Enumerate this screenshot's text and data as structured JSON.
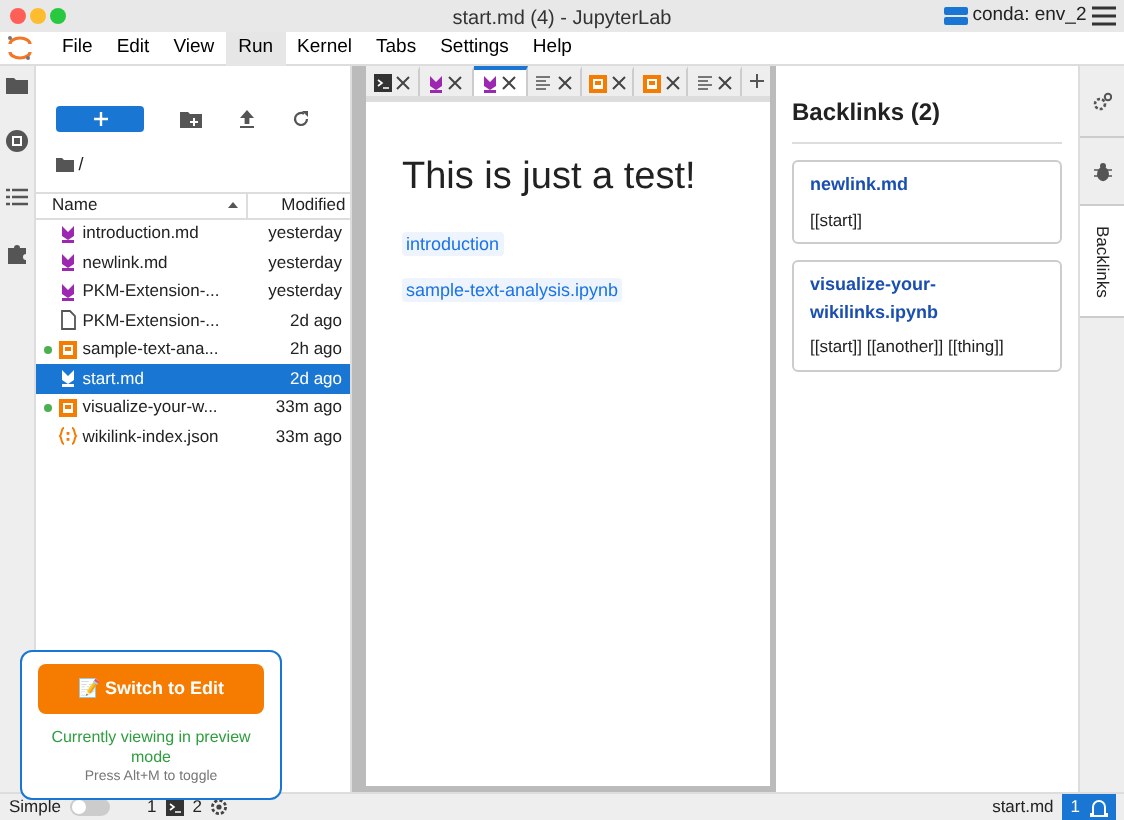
{
  "window": {
    "title": "start.md (4) - JupyterLab",
    "kernel": "conda: env_2"
  },
  "menu": [
    {
      "label": "File",
      "selected": false
    },
    {
      "label": "Edit",
      "selected": false
    },
    {
      "label": "View",
      "selected": false
    },
    {
      "label": "Run",
      "selected": true
    },
    {
      "label": "Kernel",
      "selected": false
    },
    {
      "label": "Tabs",
      "selected": false
    },
    {
      "label": "Settings",
      "selected": false
    },
    {
      "label": "Help",
      "selected": false
    }
  ],
  "file_browser": {
    "path": "/",
    "columns": [
      "Name",
      "Modified"
    ],
    "files": [
      {
        "kind": "md",
        "name": "introduction.md",
        "modified": "yesterday",
        "running": false,
        "selected": false
      },
      {
        "kind": "md",
        "name": "newlink.md",
        "modified": "yesterday",
        "running": false,
        "selected": false
      },
      {
        "kind": "md",
        "name": "PKM-Extension-...",
        "modified": "yesterday",
        "running": false,
        "selected": false
      },
      {
        "kind": "file",
        "name": "PKM-Extension-...",
        "modified": "2d ago",
        "running": false,
        "selected": false
      },
      {
        "kind": "notebook",
        "name": "sample-text-ana...",
        "modified": "2h ago",
        "running": true,
        "selected": false
      },
      {
        "kind": "md",
        "name": "start.md",
        "modified": "2d ago",
        "running": false,
        "selected": true
      },
      {
        "kind": "notebook",
        "name": "visualize-your-w...",
        "modified": "33m ago",
        "running": true,
        "selected": false
      },
      {
        "kind": "json",
        "name": "wikilink-index.json",
        "modified": "33m ago",
        "running": false,
        "selected": false
      }
    ]
  },
  "tabs": [
    {
      "kind": "terminal",
      "selected": false
    },
    {
      "kind": "md",
      "selected": false
    },
    {
      "kind": "md",
      "selected": true
    },
    {
      "kind": "text",
      "selected": false
    },
    {
      "kind": "notebook",
      "selected": false
    },
    {
      "kind": "notebook",
      "selected": false
    },
    {
      "kind": "text",
      "selected": false
    }
  ],
  "document": {
    "heading": "This is just a test!",
    "links": [
      "introduction",
      "sample-text-analysis.ipynb"
    ]
  },
  "backlinks": {
    "title": "Backlinks (2)",
    "items": [
      {
        "name": "newlink.md",
        "links": "[[start]]"
      },
      {
        "name": "visualize-your-wikilinks.ipynb",
        "links": "[[start]] [[another]] [[thing]]"
      }
    ]
  },
  "right_tabs": [
    {
      "kind": "gear",
      "selected": false
    },
    {
      "kind": "bug",
      "selected": false
    },
    {
      "kind": "label",
      "label": "Backlinks",
      "selected": true
    },
    {
      "kind": "blank",
      "selected": false
    }
  ],
  "popup": {
    "button": "📝 Switch to Edit",
    "status": "Currently viewing in preview mode",
    "hint": "Press Alt+M to toggle"
  },
  "status_bar": {
    "mode_label": "Simple",
    "simple_on": false,
    "terminals": "1",
    "kernels": "2",
    "file": "start.md",
    "notifications": "1"
  }
}
